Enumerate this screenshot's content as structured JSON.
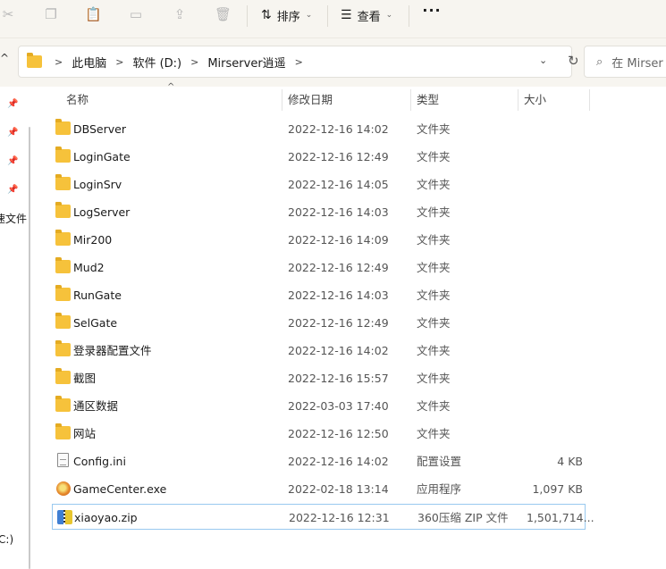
{
  "toolbar": {
    "sort_label": "排序",
    "view_label": "查看",
    "more_label": "···"
  },
  "address": {
    "crumbs": [
      "此电脑",
      "软件 (D:)",
      "Mirserver逍遥"
    ]
  },
  "search": {
    "placeholder": "在 Mirser"
  },
  "nav": {
    "partial_label_1": "速文件",
    "partial_label_2": ":C:)"
  },
  "columns": {
    "name": "名称",
    "date": "修改日期",
    "type": "类型",
    "size": "大小"
  },
  "files": [
    {
      "name": "DBServer",
      "date": "2022-12-16 14:02",
      "type": "文件夹",
      "size": "",
      "icon": "folder-icon"
    },
    {
      "name": "LoginGate",
      "date": "2022-12-16 12:49",
      "type": "文件夹",
      "size": "",
      "icon": "folder-icon"
    },
    {
      "name": "LoginSrv",
      "date": "2022-12-16 14:05",
      "type": "文件夹",
      "size": "",
      "icon": "folder-icon"
    },
    {
      "name": "LogServer",
      "date": "2022-12-16 14:03",
      "type": "文件夹",
      "size": "",
      "icon": "folder-icon"
    },
    {
      "name": "Mir200",
      "date": "2022-12-16 14:09",
      "type": "文件夹",
      "size": "",
      "icon": "folder-icon"
    },
    {
      "name": "Mud2",
      "date": "2022-12-16 12:49",
      "type": "文件夹",
      "size": "",
      "icon": "folder-icon"
    },
    {
      "name": "RunGate",
      "date": "2022-12-16 14:03",
      "type": "文件夹",
      "size": "",
      "icon": "folder-icon"
    },
    {
      "name": "SelGate",
      "date": "2022-12-16 12:49",
      "type": "文件夹",
      "size": "",
      "icon": "folder-icon"
    },
    {
      "name": "登录器配置文件",
      "date": "2022-12-16 14:02",
      "type": "文件夹",
      "size": "",
      "icon": "folder-icon"
    },
    {
      "name": "截图",
      "date": "2022-12-16 15:57",
      "type": "文件夹",
      "size": "",
      "icon": "folder-icon"
    },
    {
      "name": "通区数据",
      "date": "2022-03-03 17:40",
      "type": "文件夹",
      "size": "",
      "icon": "folder-icon"
    },
    {
      "name": "网站",
      "date": "2022-12-16 12:50",
      "type": "文件夹",
      "size": "",
      "icon": "folder-icon"
    },
    {
      "name": "Config.ini",
      "date": "2022-12-16 14:02",
      "type": "配置设置",
      "size": "4 KB",
      "icon": "ini-file-icon"
    },
    {
      "name": "GameCenter.exe",
      "date": "2022-02-18 13:14",
      "type": "应用程序",
      "size": "1,097 KB",
      "icon": "exe-app-icon"
    },
    {
      "name": "xiaoyao.zip",
      "date": "2022-12-16 12:31",
      "type": "360压缩 ZIP 文件",
      "size": "1,501,714...",
      "icon": "zip-archive-icon",
      "selected": true
    }
  ]
}
